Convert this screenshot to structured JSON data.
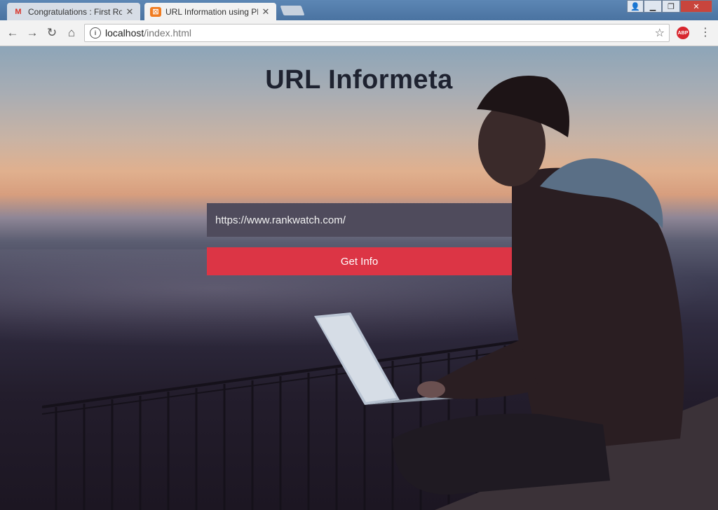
{
  "browser": {
    "tabs": [
      {
        "label": "Congratulations : First Ro",
        "favicon": "gmail-icon",
        "active": false
      },
      {
        "label": "URL Information using PH",
        "favicon": "xampp-icon",
        "active": true
      }
    ],
    "address": {
      "host": "localhost",
      "path": "/index.html"
    },
    "extension_label": "ABP"
  },
  "page": {
    "title": "URL Informeta",
    "url_input_value": "https://www.rankwatch.com/",
    "submit_label": "Get Info"
  },
  "colors": {
    "button": "#dc3545",
    "input_bg": "#4f4b5c",
    "title": "#1e2230"
  }
}
